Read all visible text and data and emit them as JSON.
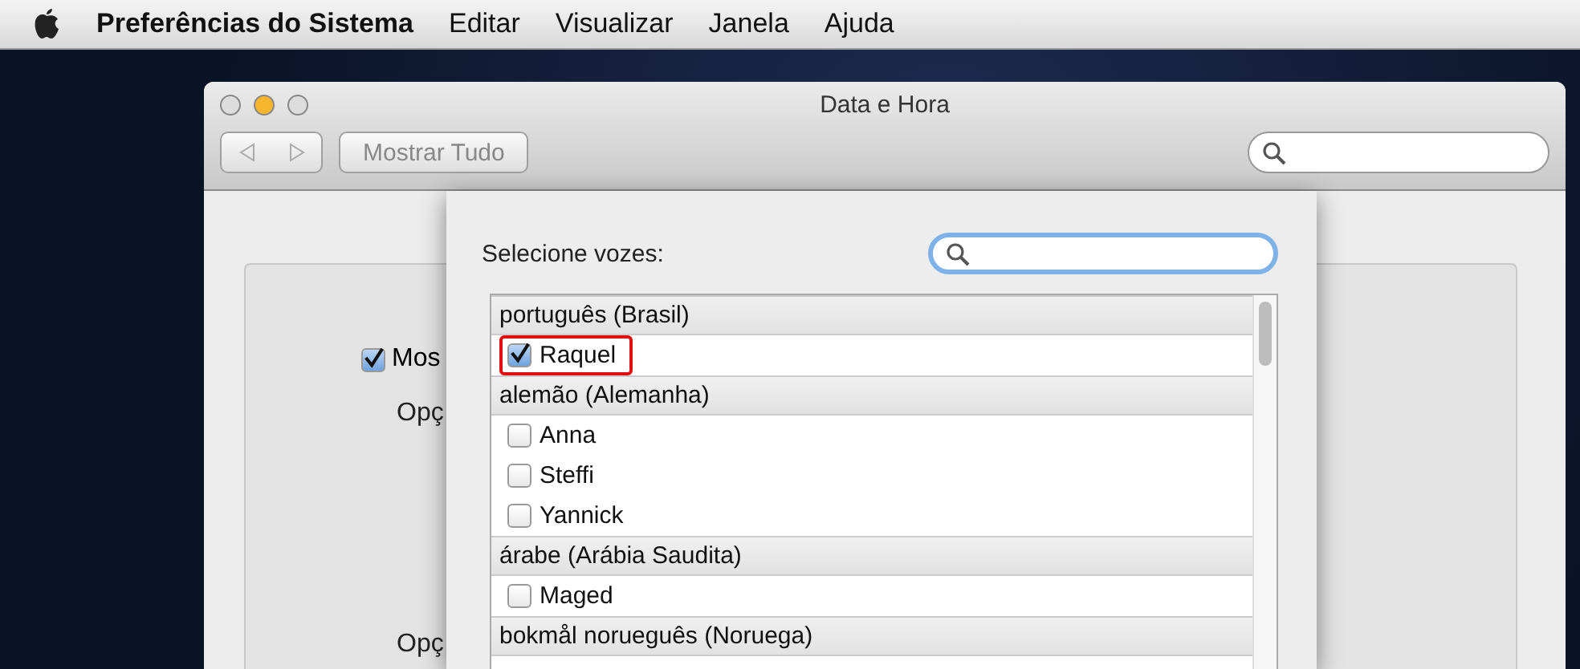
{
  "menu_bar": {
    "app_name": "Preferências do Sistema",
    "items": [
      "Editar",
      "Visualizar",
      "Janela",
      "Ajuda"
    ]
  },
  "window": {
    "title": "Data e Hora",
    "show_all_button": "Mostrar Tudo"
  },
  "background_panel": {
    "checkbox": {
      "label": "Mos",
      "checked": true
    },
    "labels": [
      "Opç",
      "Opç"
    ]
  },
  "voice_sheet": {
    "label": "Selecione vozes:",
    "groups": [
      {
        "name": "português (Brasil)",
        "voices": [
          {
            "name": "Raquel",
            "checked": true,
            "highlighted": true
          }
        ]
      },
      {
        "name": "alemão (Alemanha)",
        "voices": [
          {
            "name": "Anna",
            "checked": false,
            "highlighted": false
          },
          {
            "name": "Steffi",
            "checked": false,
            "highlighted": false
          },
          {
            "name": "Yannick",
            "checked": false,
            "highlighted": false
          }
        ]
      },
      {
        "name": "árabe (Arábia Saudita)",
        "voices": [
          {
            "name": "Maged",
            "checked": false,
            "highlighted": false
          }
        ]
      },
      {
        "name": "bokmål norueguês (Noruega)"
      }
    ]
  }
}
